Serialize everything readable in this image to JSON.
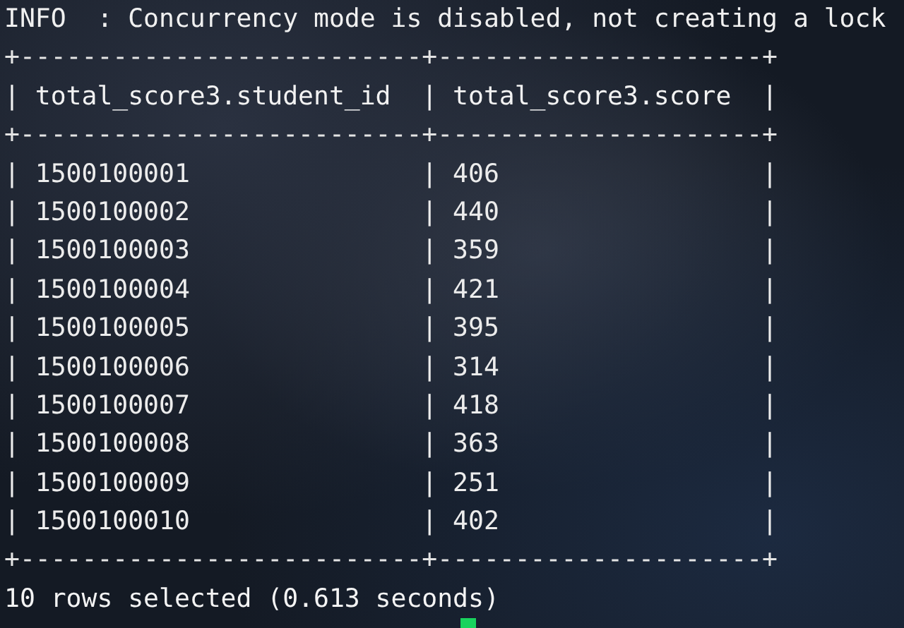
{
  "terminal": {
    "lines": [
      {
        "kind": "log",
        "text": "INFO  : Concurrency mode is disabled, not creating a lock"
      },
      {
        "kind": "border",
        "text": "+--------------------------+---------------------+"
      },
      {
        "kind": "header",
        "text": "| total_score3.student_id  | total_score3.score  |"
      },
      {
        "kind": "border",
        "text": "+--------------------------+---------------------+"
      },
      {
        "kind": "row",
        "text": "| 1500100001               | 406                 |"
      },
      {
        "kind": "row",
        "text": "| 1500100002               | 440                 |"
      },
      {
        "kind": "row",
        "text": "| 1500100003               | 359                 |"
      },
      {
        "kind": "row",
        "text": "| 1500100004               | 421                 |"
      },
      {
        "kind": "row",
        "text": "| 1500100005               | 395                 |"
      },
      {
        "kind": "row",
        "text": "| 1500100006               | 314                 |"
      },
      {
        "kind": "row",
        "text": "| 1500100007               | 418                 |"
      },
      {
        "kind": "row",
        "text": "| 1500100008               | 363                 |"
      },
      {
        "kind": "row",
        "text": "| 1500100009               | 251                 |"
      },
      {
        "kind": "row",
        "text": "| 1500100010               | 402                 |"
      },
      {
        "kind": "border",
        "text": "+--------------------------+---------------------+"
      },
      {
        "kind": "status",
        "text": "10 rows selected (0.613 seconds)"
      }
    ],
    "cursor": {
      "visible": true
    }
  }
}
